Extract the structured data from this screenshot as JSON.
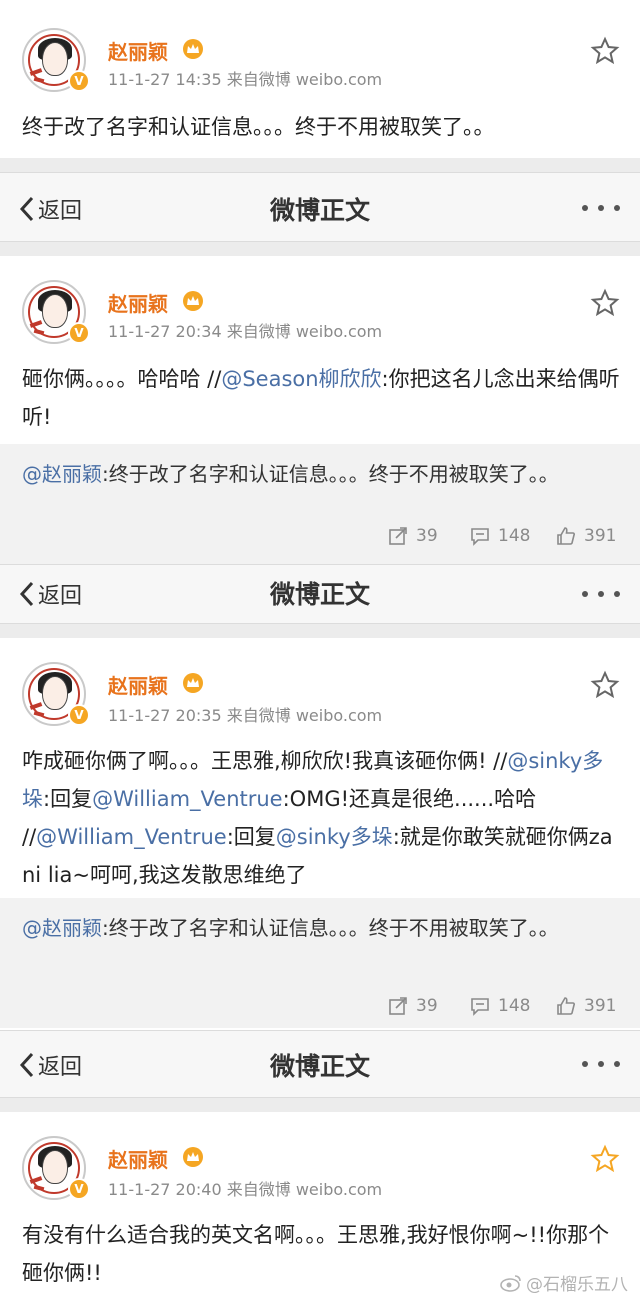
{
  "user": {
    "name": "赵丽颖",
    "verified_badge": "V"
  },
  "nav": {
    "back_label": "返回",
    "title": "微博正文"
  },
  "posts": [
    {
      "meta": "11-1-27 14:35  来自微博 weibo.com",
      "text": "终于改了名字和认证信息。。。终于不用被取笑了。。"
    },
    {
      "meta": "11-1-27 20:34  来自微博 weibo.com",
      "parts": [
        "砸你俩。。。。哈哈哈 //",
        "@Season柳欣欣",
        ":你把这名儿念出来给偶听听!"
      ],
      "quote_mention": "@赵丽颖",
      "quote_text": ":终于改了名字和认证信息。。。终于不用被取笑了。。",
      "reposts": "39",
      "comments": "148",
      "likes": "391"
    },
    {
      "meta": "11-1-27 20:35  来自微博 weibo.com",
      "parts": [
        "咋成砸你俩了啊。。。王思雅,柳欣欣!我真该砸你俩! //",
        "@sinky多垛",
        ":回复",
        "@William_Ventrue",
        ":OMG!还真是很绝......哈哈 //",
        "@William_Ventrue",
        ":回复",
        "@sinky多垛",
        ":就是你敢笑就砸你俩za ni lia~呵呵,我这发散思维绝了"
      ],
      "quote_mention": "@赵丽颖",
      "quote_text": ":终于改了名字和认证信息。。。终于不用被取笑了。。",
      "reposts": "39",
      "comments": "148",
      "likes": "391"
    },
    {
      "meta": "11-1-27 20:40  来自微博 weibo.com",
      "text": "有没有什么适合我的英文名啊。。。王思雅,我好恨你啊~!!你那个砸你俩!!"
    }
  ],
  "watermark": "@石榴乐五八",
  "colors": {
    "username": "#e8731c",
    "mention": "#4a6fa5",
    "star_active": "#f5a623"
  },
  "icons": [
    "star-icon",
    "crown-icon",
    "verified-icon",
    "back-chevron-icon",
    "more-icon",
    "repost-icon",
    "comment-icon",
    "like-icon",
    "weibo-logo-icon"
  ]
}
